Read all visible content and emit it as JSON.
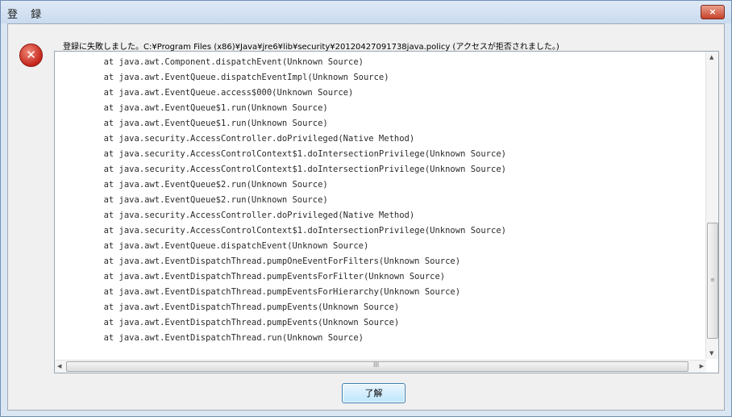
{
  "dialog": {
    "title": "登 録",
    "close_label": "×",
    "message": "登録に失敗しました。C:¥Program Files (x86)¥Java¥jre6¥lib¥security¥20120427091738java.policy (アクセスが拒否されました。)",
    "ok_label": "了解",
    "error_icon": "error-icon"
  },
  "trace_lines": [
    "at java.awt.Component.dispatchEvent(Unknown Source)",
    "at java.awt.EventQueue.dispatchEventImpl(Unknown Source)",
    "at java.awt.EventQueue.access$000(Unknown Source)",
    "at java.awt.EventQueue$1.run(Unknown Source)",
    "at java.awt.EventQueue$1.run(Unknown Source)",
    "at java.security.AccessController.doPrivileged(Native Method)",
    "at java.security.AccessControlContext$1.doIntersectionPrivilege(Unknown Source)",
    "at java.security.AccessControlContext$1.doIntersectionPrivilege(Unknown Source)",
    "at java.awt.EventQueue$2.run(Unknown Source)",
    "at java.awt.EventQueue$2.run(Unknown Source)",
    "at java.security.AccessController.doPrivileged(Native Method)",
    "at java.security.AccessControlContext$1.doIntersectionPrivilege(Unknown Source)",
    "at java.awt.EventQueue.dispatchEvent(Unknown Source)",
    "at java.awt.EventDispatchThread.pumpOneEventForFilters(Unknown Source)",
    "at java.awt.EventDispatchThread.pumpEventsForFilter(Unknown Source)",
    "at java.awt.EventDispatchThread.pumpEventsForHierarchy(Unknown Source)",
    "at java.awt.EventDispatchThread.pumpEvents(Unknown Source)",
    "at java.awt.EventDispatchThread.pumpEvents(Unknown Source)",
    "at java.awt.EventDispatchThread.run(Unknown Source)"
  ],
  "scrollbars": {
    "hscroll_grip": "III",
    "vscroll_grip": "≡"
  },
  "colors": {
    "title_bar": "#c9dbef",
    "close_button": "#c7412a",
    "error_icon": "#c4241a",
    "ok_button": "#bee6fd"
  }
}
